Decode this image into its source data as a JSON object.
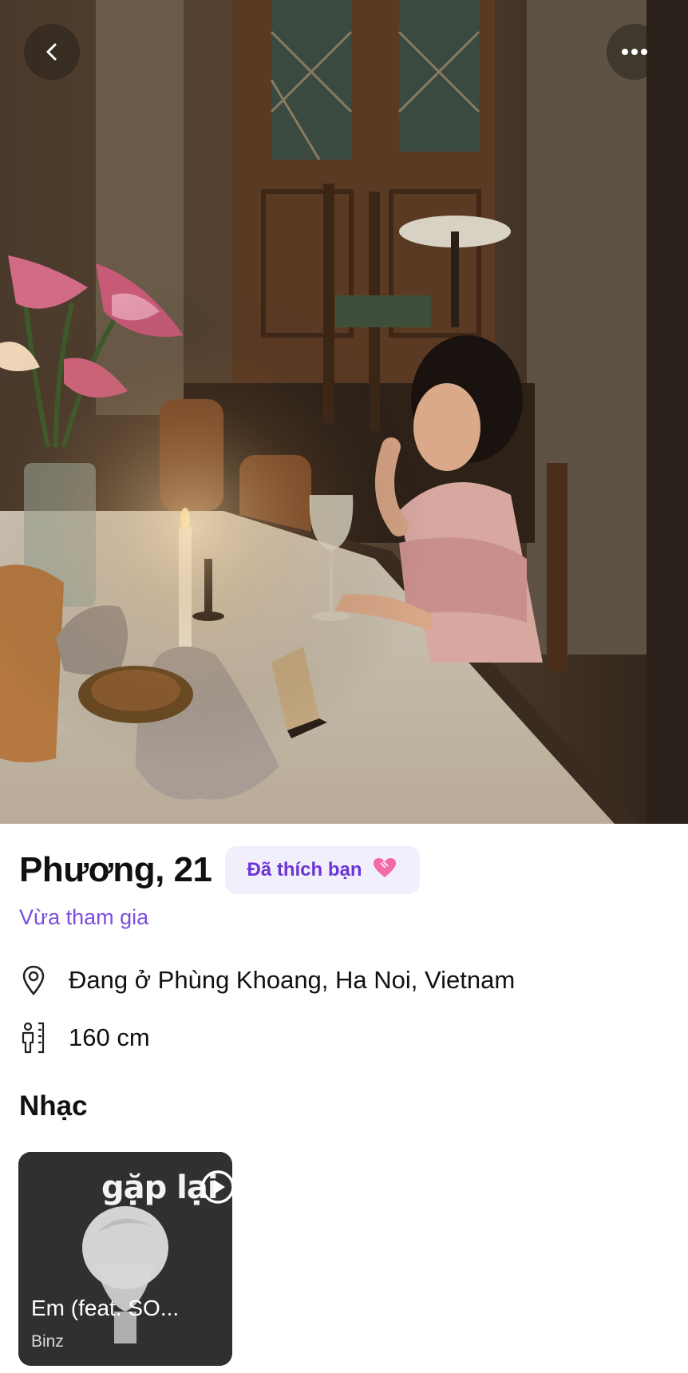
{
  "profile": {
    "name_age": "Phương, 21",
    "liked_badge": "Đã thích bạn",
    "joined": "Vừa tham gia",
    "location": "Đang ở Phùng Khoang, Ha Noi, Vietnam",
    "height": "160 cm"
  },
  "music": {
    "section_title": "Nhạc",
    "album_title": "gặp lại",
    "track": "Em (feat. SO...",
    "artist": "Binz"
  },
  "icons": {
    "back": "chevron-left-icon",
    "more": "ellipsis-icon",
    "heart": "heart-icon",
    "location": "map-pin-icon",
    "height": "ruler-person-icon",
    "play": "play-circle-icon"
  },
  "colors": {
    "accent": "#7b4fdc",
    "badge_bg": "#f2effc",
    "badge_text": "#6b35d6",
    "heart": "#f26aa8"
  }
}
